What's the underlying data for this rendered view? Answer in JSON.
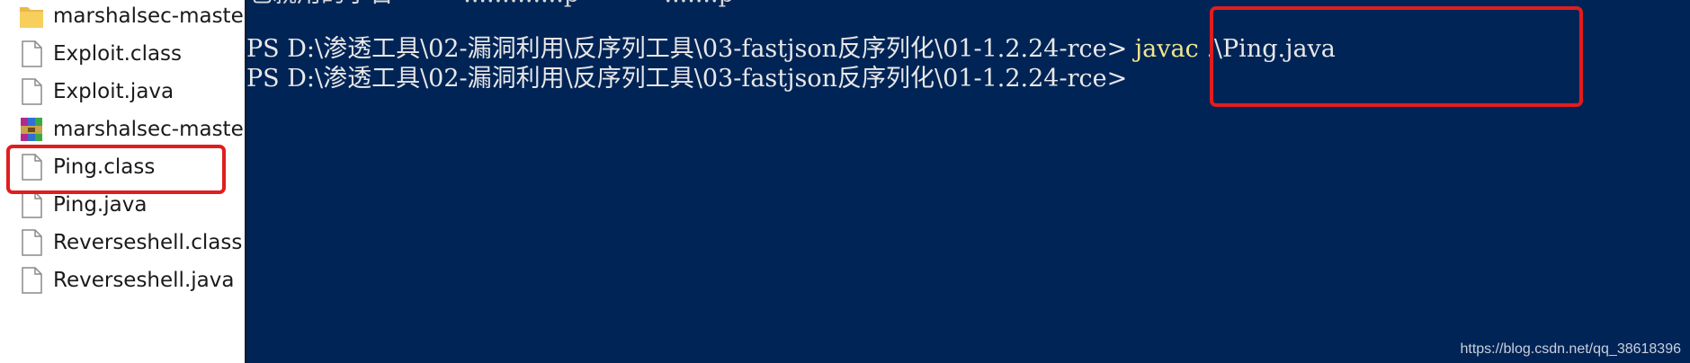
{
  "explorer": {
    "files": [
      {
        "name": "marshalsec-master",
        "icon": "folder-icon"
      },
      {
        "name": "Exploit.class",
        "icon": "file-icon"
      },
      {
        "name": "Exploit.java",
        "icon": "file-icon"
      },
      {
        "name": "marshalsec-master",
        "icon": "archive-icon"
      },
      {
        "name": "Ping.class",
        "icon": "file-icon"
      },
      {
        "name": "Ping.java",
        "icon": "file-icon"
      },
      {
        "name": "Reverseshell.class",
        "icon": "file-icon"
      },
      {
        "name": "Reverseshell.java",
        "icon": "file-icon"
      }
    ]
  },
  "console": {
    "partial_line": "也就用的小台         .............p           .......p",
    "lines": [
      {
        "prompt": "PS D:\\渗透工具\\02-漏洞利用\\反序列工具\\03-fastjson反序列化\\01-1.2.24-rce> ",
        "command": "javac",
        "args": " .\\Ping.java"
      },
      {
        "prompt": "PS D:\\渗透工具\\02-漏洞利用\\反序列工具\\03-fastjson反序列化\\01-1.2.24-rce>",
        "command": "",
        "args": ""
      }
    ]
  },
  "colors": {
    "console_bg": "#012456",
    "command": "#f0e68c",
    "highlight": "#e11d1d"
  },
  "watermark": "https://blog.csdn.net/qq_38618396"
}
